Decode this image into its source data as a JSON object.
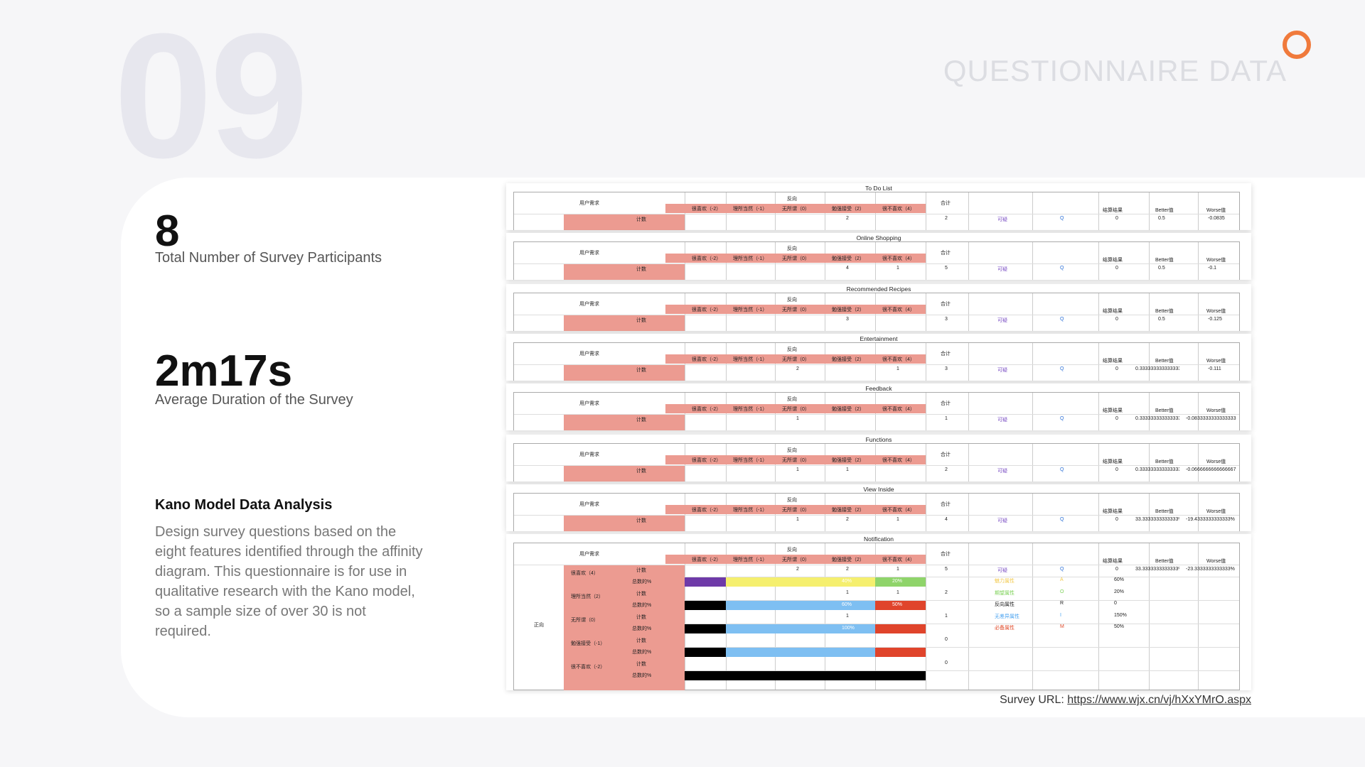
{
  "page": {
    "section_number": "09",
    "section_title": "QUESTIONNAIRE DATA"
  },
  "stats": [
    {
      "value": "8",
      "label": "Total Number of Survey Participants"
    },
    {
      "value": "2m17s",
      "label": "Average Duration of the Survey"
    }
  ],
  "kano": {
    "title": "Kano Model Data Analysis",
    "description": "Design survey questions based on the eight features identified through the affinity diagram. This questionnaire is for use in qualitative research with the Kano model, so a sample size of over 30 is not required."
  },
  "survey": {
    "label": "Survey URL: ",
    "url": "https://www.wjx.cn/vj/hXxYMrO.aspx"
  },
  "table_headers": {
    "need": "用户需求",
    "reverse": "反向",
    "total": "合计",
    "result": "结算结果",
    "better": "Better值",
    "worse": "Worse值",
    "count": "计数",
    "answers": [
      "很喜欢（-2）",
      "理所当然（-1）",
      "无所谓（0）",
      "勉强接受（2）",
      "很不喜欢（4）"
    ],
    "positive": "正向",
    "pct": "总数的%"
  },
  "features": [
    {
      "name": "To Do List",
      "counts": [
        "",
        "",
        "",
        "2",
        ""
      ],
      "total": "2",
      "category": "可疑",
      "code": "Q",
      "result": "0",
      "better": "0.5",
      "worse": "-0.0835"
    },
    {
      "name": "Online Shopping",
      "counts": [
        "",
        "",
        "",
        "4",
        "1"
      ],
      "total": "5",
      "category": "可疑",
      "code": "Q",
      "result": "0",
      "better": "0.5",
      "worse": "-0.1"
    },
    {
      "name": "Recommended Recipes",
      "counts": [
        "",
        "",
        "",
        "3",
        ""
      ],
      "total": "3",
      "category": "可疑",
      "code": "Q",
      "result": "0",
      "better": "0.5",
      "worse": "-0.125"
    },
    {
      "name": "Entertainment",
      "counts": [
        "",
        "",
        "2",
        "",
        "1"
      ],
      "total": "3",
      "category": "可疑",
      "code": "Q",
      "result": "0",
      "better": "0.333333333333333",
      "worse": "-0.111"
    },
    {
      "name": "Feedback",
      "counts": [
        "",
        "",
        "1",
        "",
        ""
      ],
      "total": "1",
      "category": "可疑",
      "code": "Q",
      "result": "0",
      "better": "0.333333333333333",
      "worse": "-0.0833333333333333"
    },
    {
      "name": "Functions",
      "counts": [
        "",
        "",
        "1",
        "1",
        ""
      ],
      "total": "2",
      "category": "可疑",
      "code": "Q",
      "result": "0",
      "better": "0.333333333333333",
      "worse": "-0.0666666666666667"
    },
    {
      "name": "View Inside",
      "counts": [
        "",
        "",
        "1",
        "2",
        "1"
      ],
      "total": "4",
      "category": "可疑",
      "code": "Q",
      "result": "0",
      "better": "33.3333333333333%",
      "worse": "-19.4333333333333%"
    },
    {
      "name": "Notification",
      "counts": [
        "",
        "",
        "2",
        "2",
        "1"
      ],
      "total": "5",
      "category": "可疑",
      "code": "Q",
      "result": "0",
      "better": "33.3333333333333%",
      "worse": "-23.3333333333333%"
    }
  ],
  "notification_detail": {
    "row_labels": [
      "很喜欢（4）",
      "理所当然（2）",
      "无所谓（0）",
      "勉强接受（-1）",
      "很不喜欢（-2）"
    ],
    "extra_counts": [
      {
        "counts": [
          "",
          "",
          "",
          "1",
          "1"
        ],
        "total": "2"
      },
      {
        "counts": [
          "",
          "",
          "",
          "1",
          ""
        ],
        "total": "1"
      },
      {
        "counts": [
          "",
          "",
          "",
          "",
          ""
        ],
        "total": "0"
      },
      {
        "counts": [
          "",
          "",
          "",
          "",
          ""
        ],
        "total": "0"
      }
    ],
    "bar_pcts": [
      "40%",
      "20%",
      "60%",
      "50%",
      "100%"
    ],
    "legend": [
      {
        "label": "魅力属性",
        "code": "A",
        "value": "60%",
        "color": "#f2c94c"
      },
      {
        "label": "期望属性",
        "code": "O",
        "value": "20%",
        "color": "#7bd155"
      },
      {
        "label": "反向属性",
        "code": "R",
        "value": "0",
        "color": "#222222"
      },
      {
        "label": "无差异属性",
        "code": "I",
        "value": "150%",
        "color": "#4aa3f0"
      },
      {
        "label": "必备属性",
        "code": "M",
        "value": "50%",
        "color": "#e04b2a"
      }
    ]
  },
  "colors": {
    "accent": "#f07a3c",
    "header_salmon": "#ec9b91",
    "purple": "#6e3aa8",
    "yellow": "#f5ef6e",
    "green": "#8fd46a",
    "blue": "#7ebff2",
    "red": "#e0442b",
    "black": "#000000"
  }
}
